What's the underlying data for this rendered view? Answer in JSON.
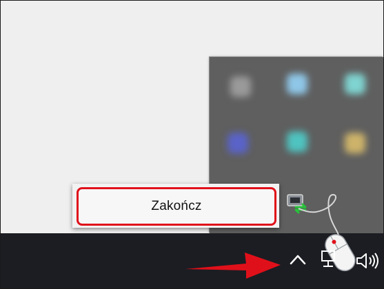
{
  "context_menu": {
    "items": [
      {
        "label": "Zakończ"
      }
    ]
  },
  "tray_overflow": {
    "icons": [
      {
        "name": "blurred-app-icon-1",
        "color": "#9a9a9a"
      },
      {
        "name": "blurred-app-icon-2",
        "color": "#8fc7e8"
      },
      {
        "name": "blurred-app-icon-3",
        "color": "#7fd3d0"
      },
      {
        "name": "blurred-app-icon-4",
        "color": "#5a63c8"
      },
      {
        "name": "blurred-app-icon-5",
        "color": "#4fc3c0"
      },
      {
        "name": "blurred-app-icon-6",
        "color": "#cdb36a"
      }
    ]
  },
  "taskbar": {
    "system_tray": [
      "chevron-up-icon",
      "network-icon",
      "volume-icon"
    ]
  },
  "colors": {
    "highlight": "#e0101a",
    "taskbar": "#1c1d22",
    "overflow_panel": "#5f5f5f"
  }
}
